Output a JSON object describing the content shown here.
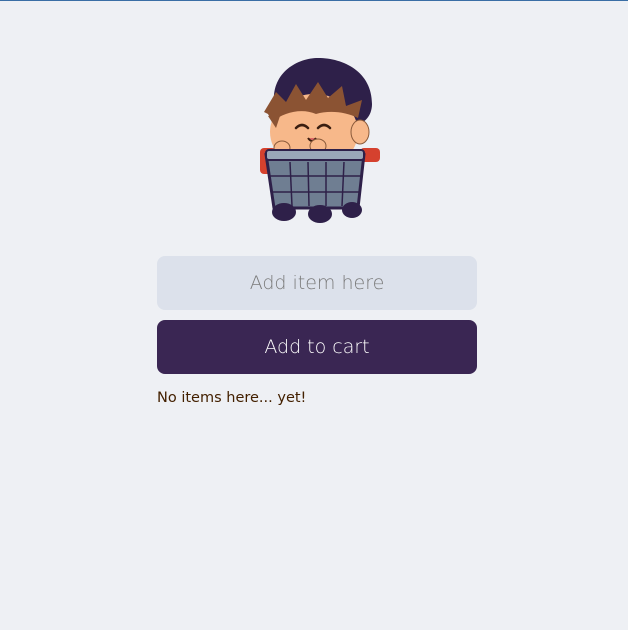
{
  "colors": {
    "page_background": "#EEF0F4",
    "input_background": "#DCE1EB",
    "button_background": "#3A2653",
    "button_text": "#FDFDFD",
    "text": "#432000",
    "placeholder": "#7A7A7A"
  },
  "mascot": {
    "icon": "cat-in-shopping-cart-icon"
  },
  "form": {
    "input_value": "",
    "input_placeholder": "Add item here",
    "button_label": "Add to cart"
  },
  "list": {
    "empty_message": "No items here... yet!"
  }
}
